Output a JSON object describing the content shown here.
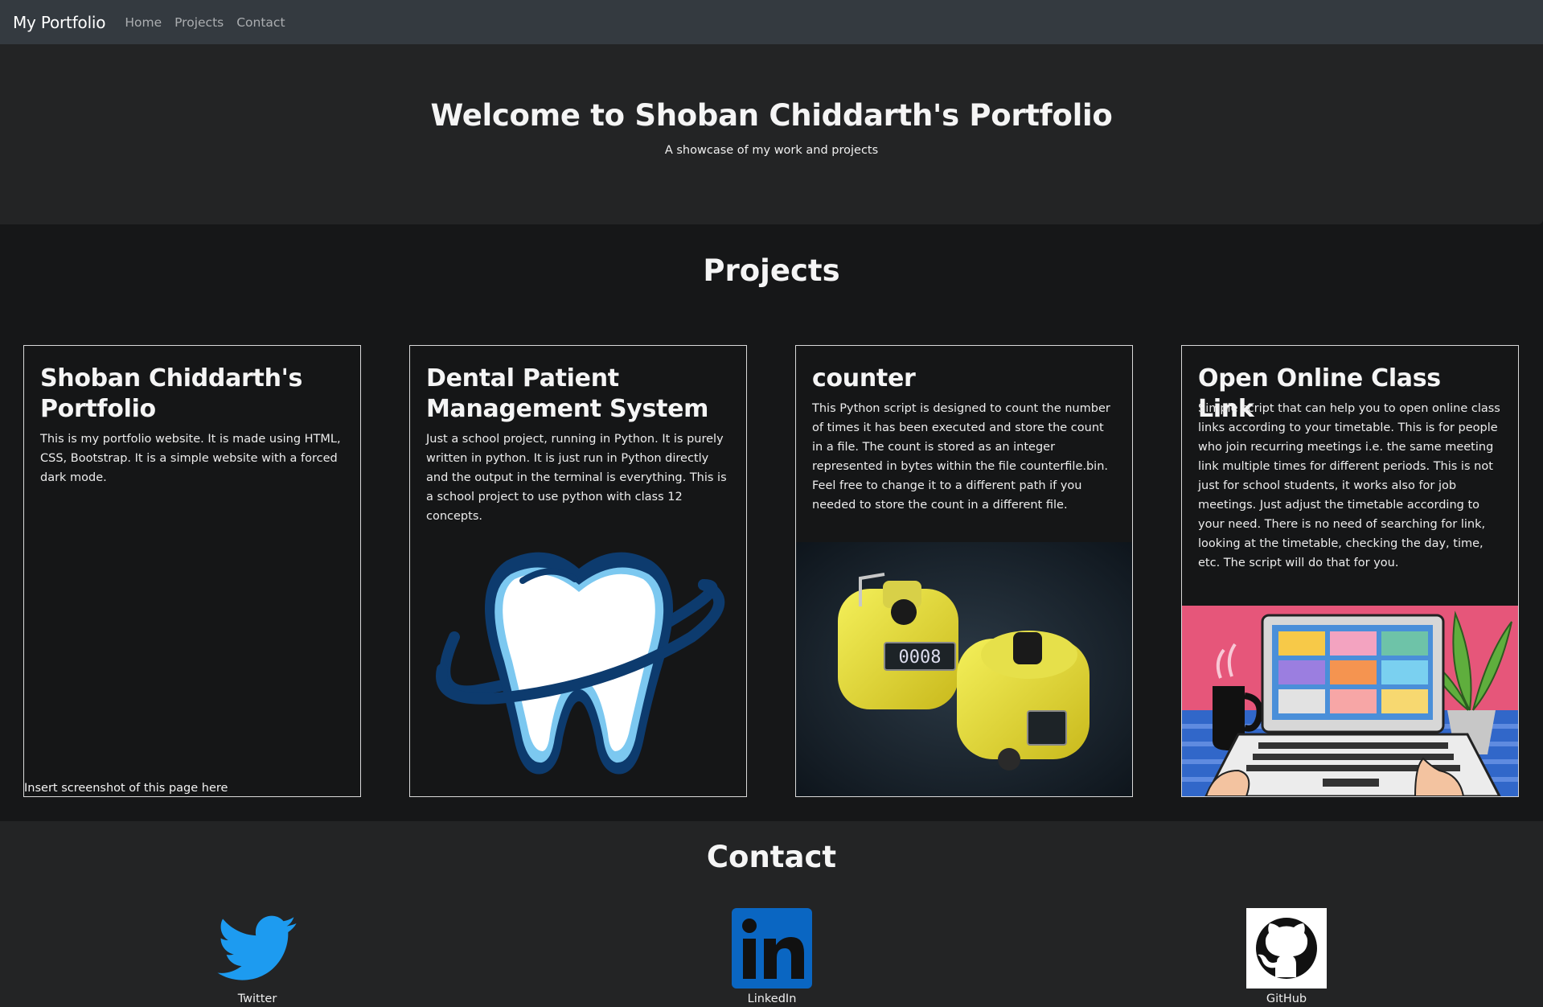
{
  "nav": {
    "brand": "My Portfolio",
    "links": [
      "Home",
      "Projects",
      "Contact"
    ]
  },
  "hero": {
    "title": "Welcome to Shoban Chiddarth's Portfolio",
    "subtitle": "A showcase of my work and projects"
  },
  "projects": {
    "heading": "Projects",
    "cards": [
      {
        "title": "Shoban Chiddarth's Portfolio",
        "text": "This is my portfolio website. It is made using HTML, CSS, Bootstrap. It is a simple website with a forced dark mode.",
        "image_alt": "Insert screenshot of this page here",
        "icon": "broken-image"
      },
      {
        "title": "Dental Patient Management System",
        "text": "Just a school project, running in Python. It is purely written in python. It is just run in Python directly and the output in the terminal is everything. This is a school project to use python with class 12 concepts.",
        "icon": "tooth-logo"
      },
      {
        "title": "counter",
        "text": "This Python script is designed to count the number of times it has been executed and store the count in a file. The count is stored as an integer represented in bytes within the file counterfile.bin. Feel free to change it to a different path if you needed to store the count in a different file.",
        "icon": "tally-counter-photo"
      },
      {
        "title": "Open Online Class Link",
        "text": "Simple script that can help you to open online class links according to your timetable. This is for people who join recurring meetings i.e. the same meeting link multiple times for different periods. This is not just for school students, it works also for job meetings. Just adjust the timetable according to your need. There is no need of searching for link, looking at the timetable, checking the day, time, etc. The script will do that for you.",
        "icon": "video-call-illustration"
      }
    ]
  },
  "contact": {
    "heading": "Contact",
    "links": [
      {
        "label": "Twitter",
        "icon": "twitter-icon",
        "color": "#1d9bf0"
      },
      {
        "label": "LinkedIn",
        "icon": "linkedin-icon",
        "color": "#0a66c2"
      },
      {
        "label": "GitHub",
        "icon": "github-icon",
        "color": "#000000"
      }
    ]
  }
}
